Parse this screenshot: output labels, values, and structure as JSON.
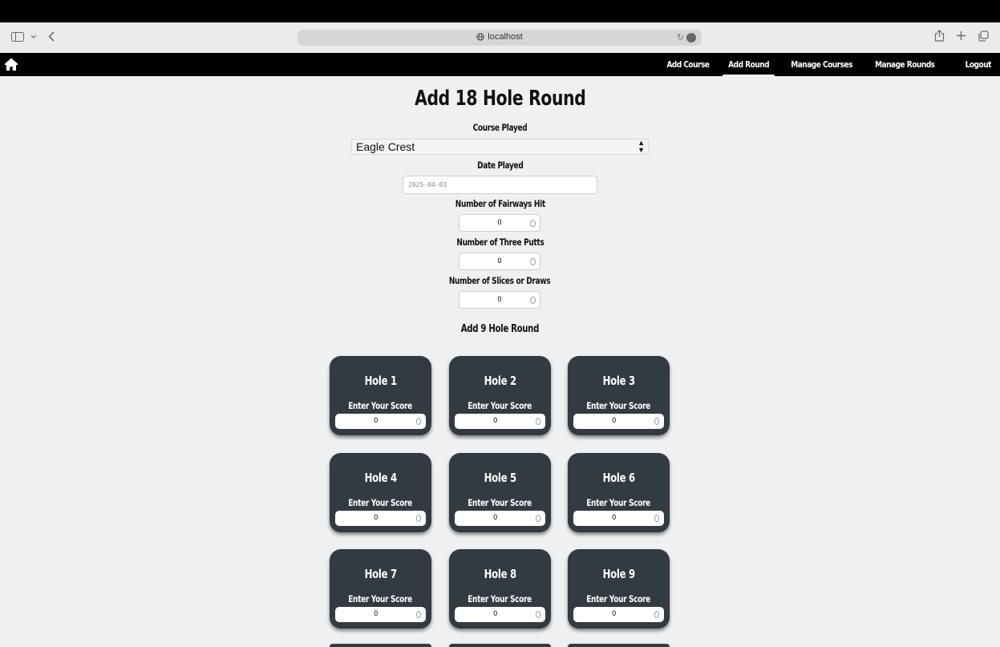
{
  "browser": {
    "url": "localhost"
  },
  "nav": {
    "links": [
      "Add Course",
      "Add Round",
      "Manage Courses",
      "Manage Rounds",
      "Logout"
    ],
    "active": "Add Round"
  },
  "form": {
    "title": "Add 18 Hole Round",
    "course_label": "Course Played",
    "course_value": "Eagle Crest",
    "date_label": "Date Played",
    "date_value": "2025-04-03",
    "fairways_label": "Number of Fairways Hit",
    "fairways_value": "0",
    "three_putts_label": "Number of Three Putts",
    "three_putts_value": "0",
    "slices_label": "Number of Slices or Draws",
    "slices_value": "0",
    "switch_link": "Add 9 Hole Round"
  },
  "holes": {
    "enter_label": "Enter Your Score",
    "items": [
      {
        "title": "Hole 1",
        "score": "0"
      },
      {
        "title": "Hole 2",
        "score": "0"
      },
      {
        "title": "Hole 3",
        "score": "0"
      },
      {
        "title": "Hole 4",
        "score": "0"
      },
      {
        "title": "Hole 5",
        "score": "0"
      },
      {
        "title": "Hole 6",
        "score": "0"
      },
      {
        "title": "Hole 7",
        "score": "0"
      },
      {
        "title": "Hole 8",
        "score": "0"
      },
      {
        "title": "Hole 9",
        "score": "0"
      }
    ]
  }
}
